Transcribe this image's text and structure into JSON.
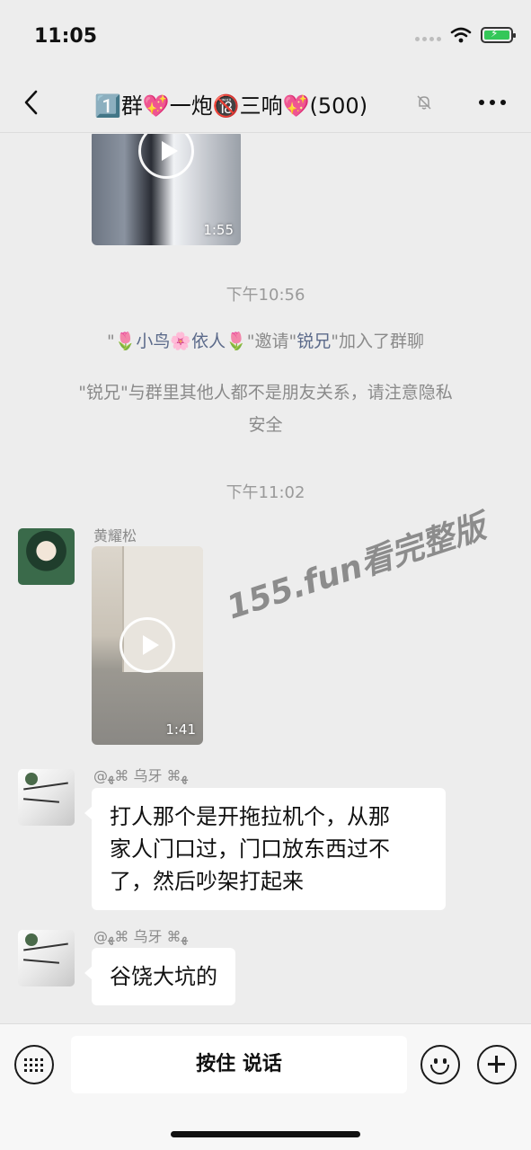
{
  "status_bar": {
    "time": "11:05"
  },
  "nav": {
    "title": "1️⃣群💖一炮🔞三响💖(500)",
    "back_icon": "chevron-left-icon",
    "mute_icon": "bell-slash-icon",
    "more_icon": "ellipsis-icon"
  },
  "messages": {
    "video1_duration": "1:55",
    "time_1": "下午10:56",
    "invite_note": {
      "q1": "\"",
      "inviter": "🌷小鸟🌸依人🌷",
      "mid": "\"邀请\"",
      "invitee": "锐兄",
      "tail": "\"加入了群聊"
    },
    "privacy_note_line1": "\"锐兄\"与群里其他人都不是朋友关系，请注意隐私",
    "privacy_note_line2": "安全",
    "time_2": "下午11:02",
    "msg1": {
      "sender": "黄耀松",
      "video_duration": "1:41"
    },
    "msg2": {
      "sender": "@ﻬ⌘ 乌牙 ⌘ﻬ",
      "line1": "打人那个是开拖拉机个，从那",
      "line2": "家人门口过，门口放东西过不",
      "line3": "了，然后吵架打起来"
    },
    "msg3": {
      "sender": "@ﻬ⌘ 乌牙 ⌘ﻬ",
      "text": "谷饶大坑的"
    }
  },
  "watermark": "155.fun看完整版",
  "input_bar": {
    "hold_to_talk": "按住 说话"
  }
}
